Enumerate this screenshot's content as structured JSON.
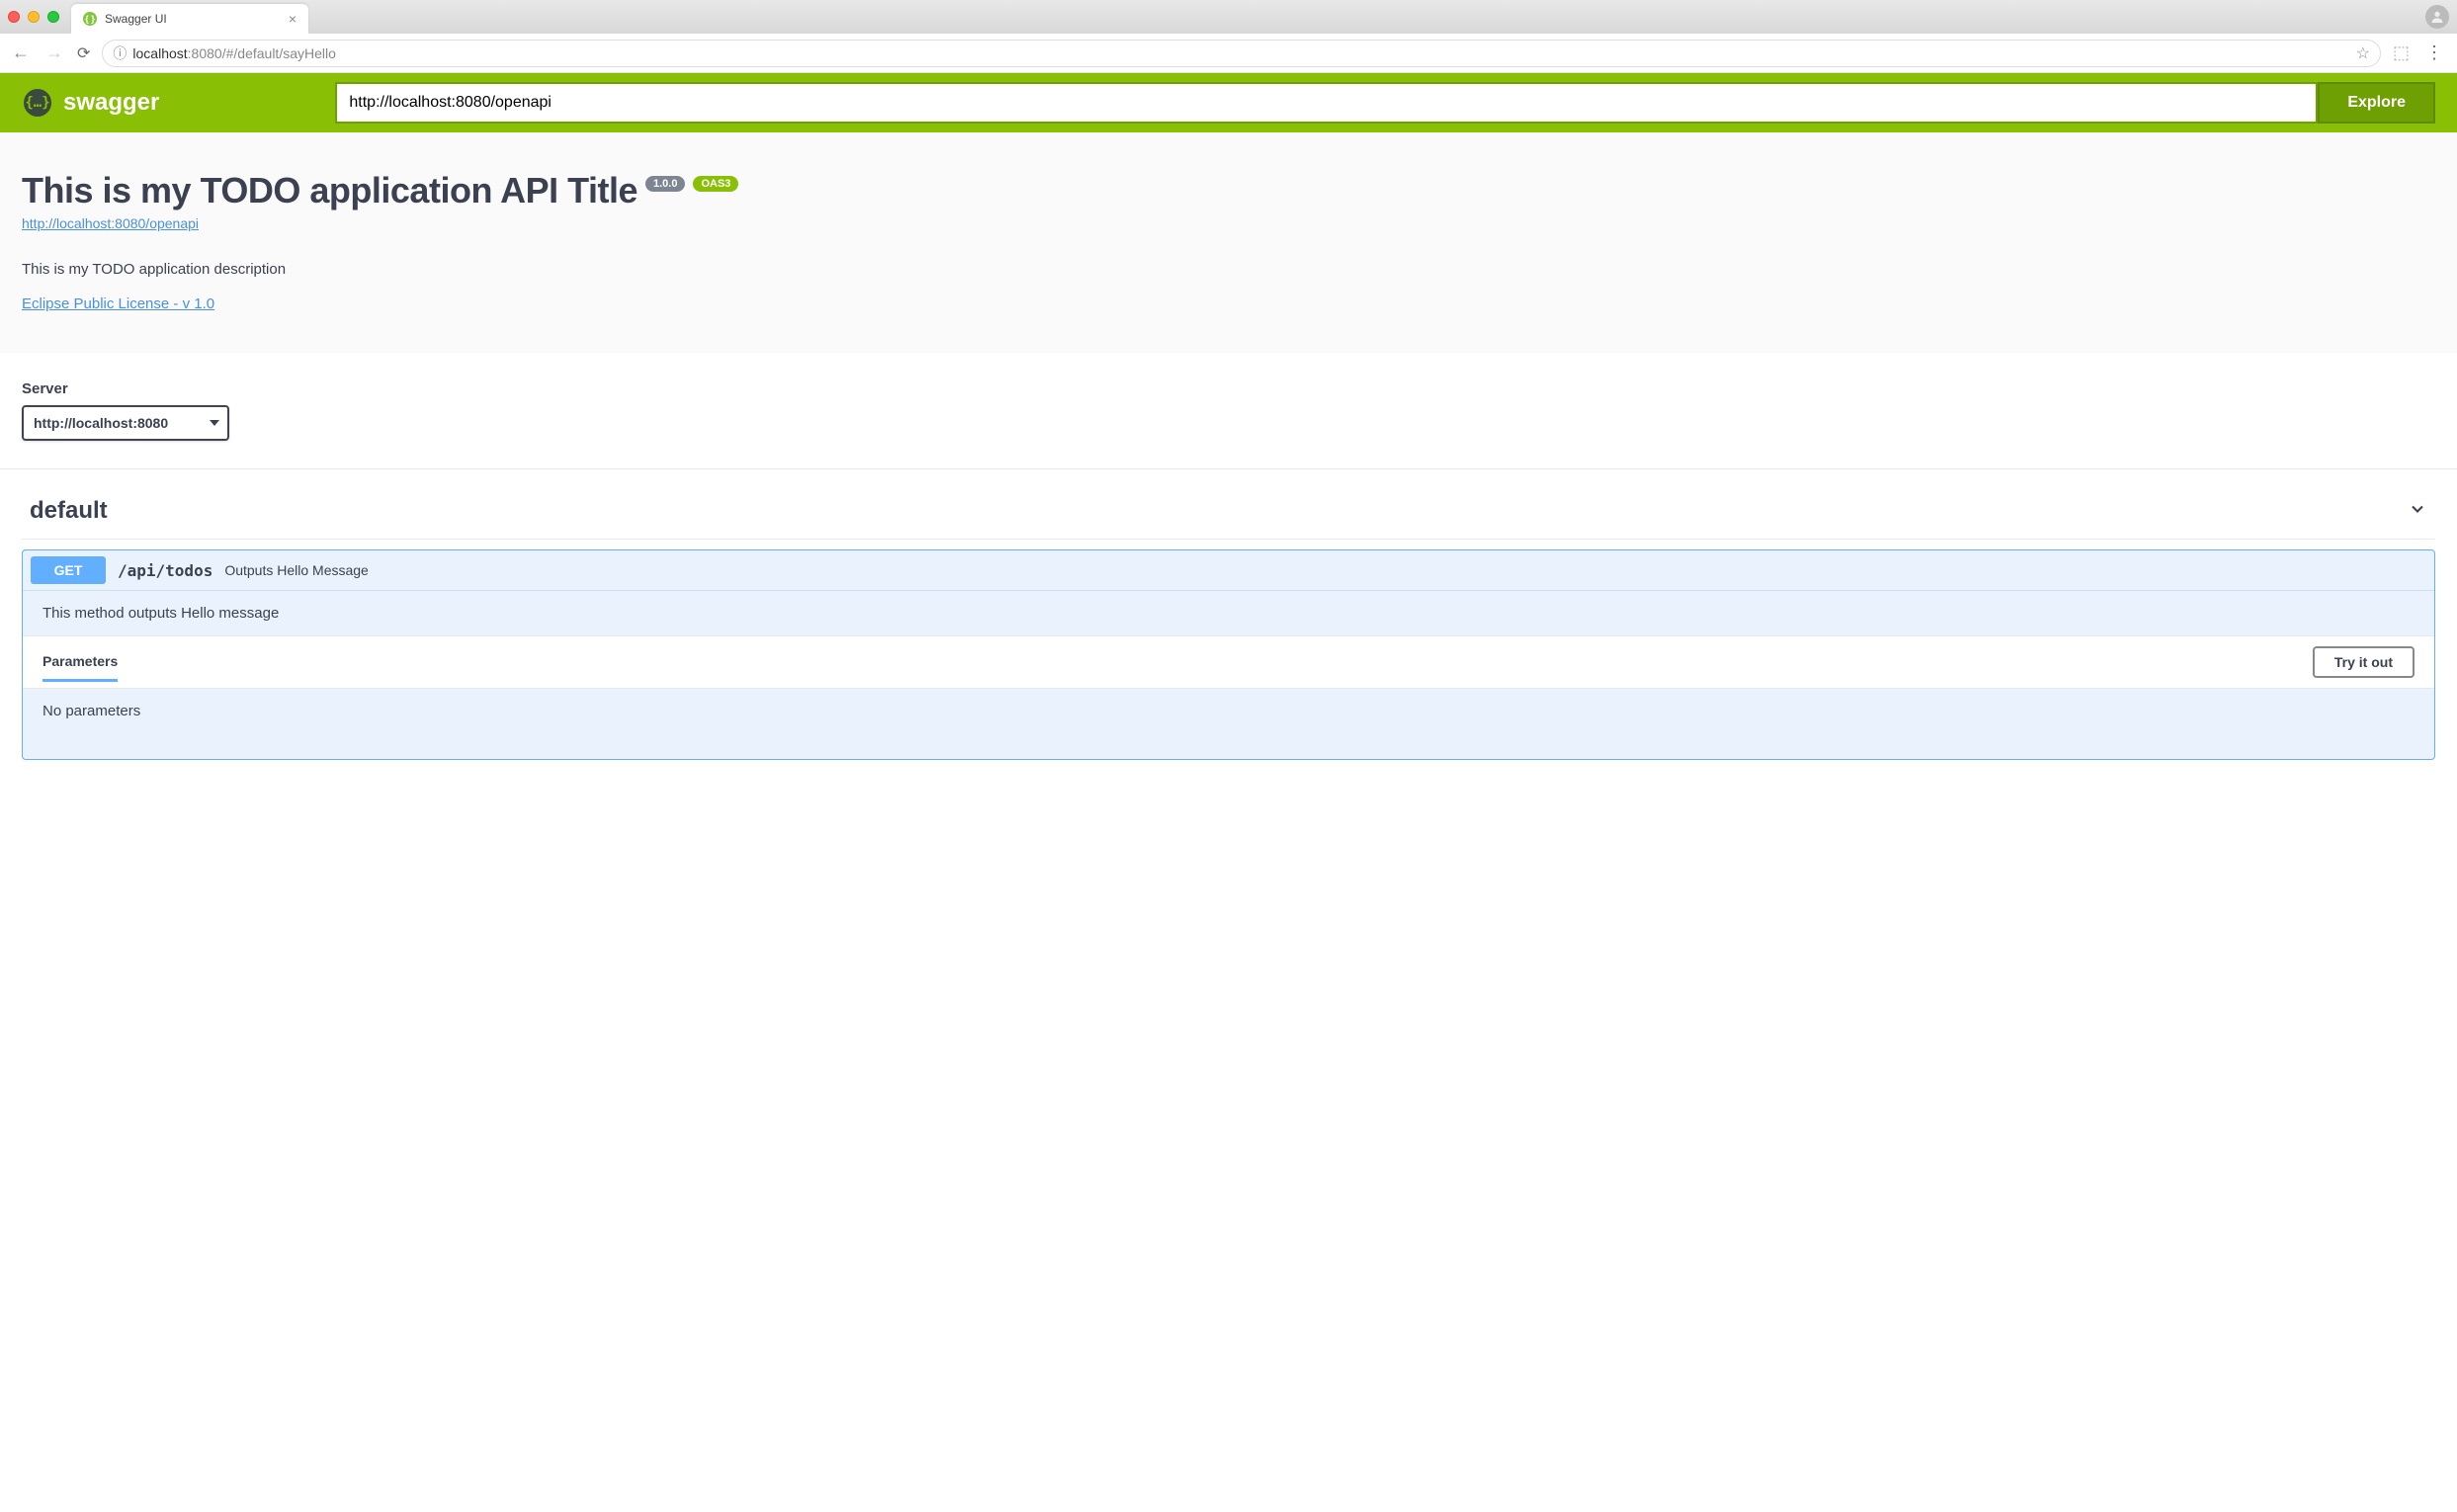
{
  "browser": {
    "tab_title": "Swagger UI",
    "url_host": "localhost",
    "url_port": ":8080",
    "url_path": "/#/default/sayHello"
  },
  "topbar": {
    "brand": "swagger",
    "spec_input_value": "http://localhost:8080/openapi",
    "explore_label": "Explore"
  },
  "info": {
    "title": "This is my TODO application API Title",
    "version": "1.0.0",
    "oas_label": "OAS3",
    "spec_url_text": "http://localhost:8080/openapi",
    "description": "This is my TODO application description",
    "license_text": "Eclipse Public License - v 1.0"
  },
  "server": {
    "label": "Server",
    "selected": "http://localhost:8080"
  },
  "tag": {
    "name": "default"
  },
  "operation": {
    "method": "GET",
    "path": "/api/todos",
    "summary": "Outputs Hello Message",
    "description": "This method outputs Hello message",
    "parameters_label": "Parameters",
    "tryitout_label": "Try it out",
    "no_params": "No parameters"
  }
}
